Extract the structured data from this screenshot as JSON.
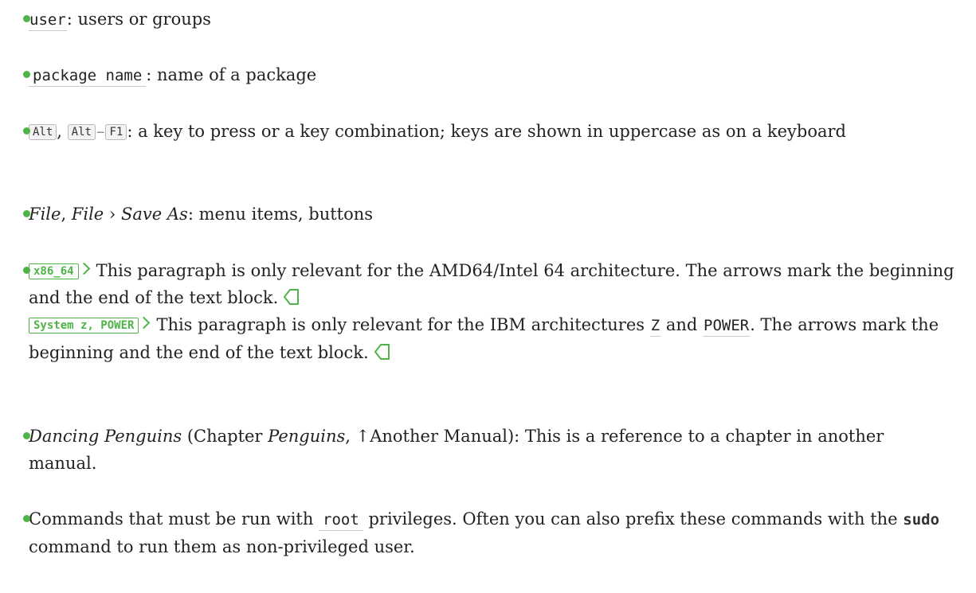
{
  "list": {
    "item1": {
      "code": "user",
      "text": ": users or groups"
    },
    "item2": {
      "code": "package name",
      "text": ": name of a package"
    },
    "item3": {
      "key1": "Alt",
      "comma": ", ",
      "key2": "Alt",
      "key_sep": "–",
      "key3": "F1",
      "text": ": a key to press or a key combination; keys are shown in uppercase as on a keyboard"
    },
    "item4": {
      "menu1": "File",
      "comma": ", ",
      "menu2": "File",
      "arrow": " › ",
      "menu3": "Save As",
      "text": ": menu items, buttons"
    },
    "item5": {
      "arch1_label": "x86_64",
      "para1": "This paragraph is only relevant for the AMD64/Intel 64 architecture. The arrows mark the beginning and the end of the text block.",
      "arch2_label": "System z, POWER",
      "para2_pre": "This paragraph is only relevant for the IBM architectures ",
      "code_z": "Z",
      "para2_and": " and ",
      "code_power": "POWER",
      "para2_post": ". The arrows mark the beginning and the end of the text block."
    },
    "item6": {
      "title": "Dancing Penguins",
      "open": " (Chapter ",
      "chapter": "Penguins",
      "ref": ", ↑Another Manual)",
      "text": ": This is a reference to a chapter in another manual."
    },
    "item7": {
      "pre": "Commands that must be run with ",
      "code": "root",
      "mid": " privileges. Often you can also prefix these commands with the ",
      "cmd": "sudo",
      "post": " command to run them as non-privileged user."
    }
  },
  "colors": {
    "accent": "#4fb447",
    "text": "#222222"
  }
}
